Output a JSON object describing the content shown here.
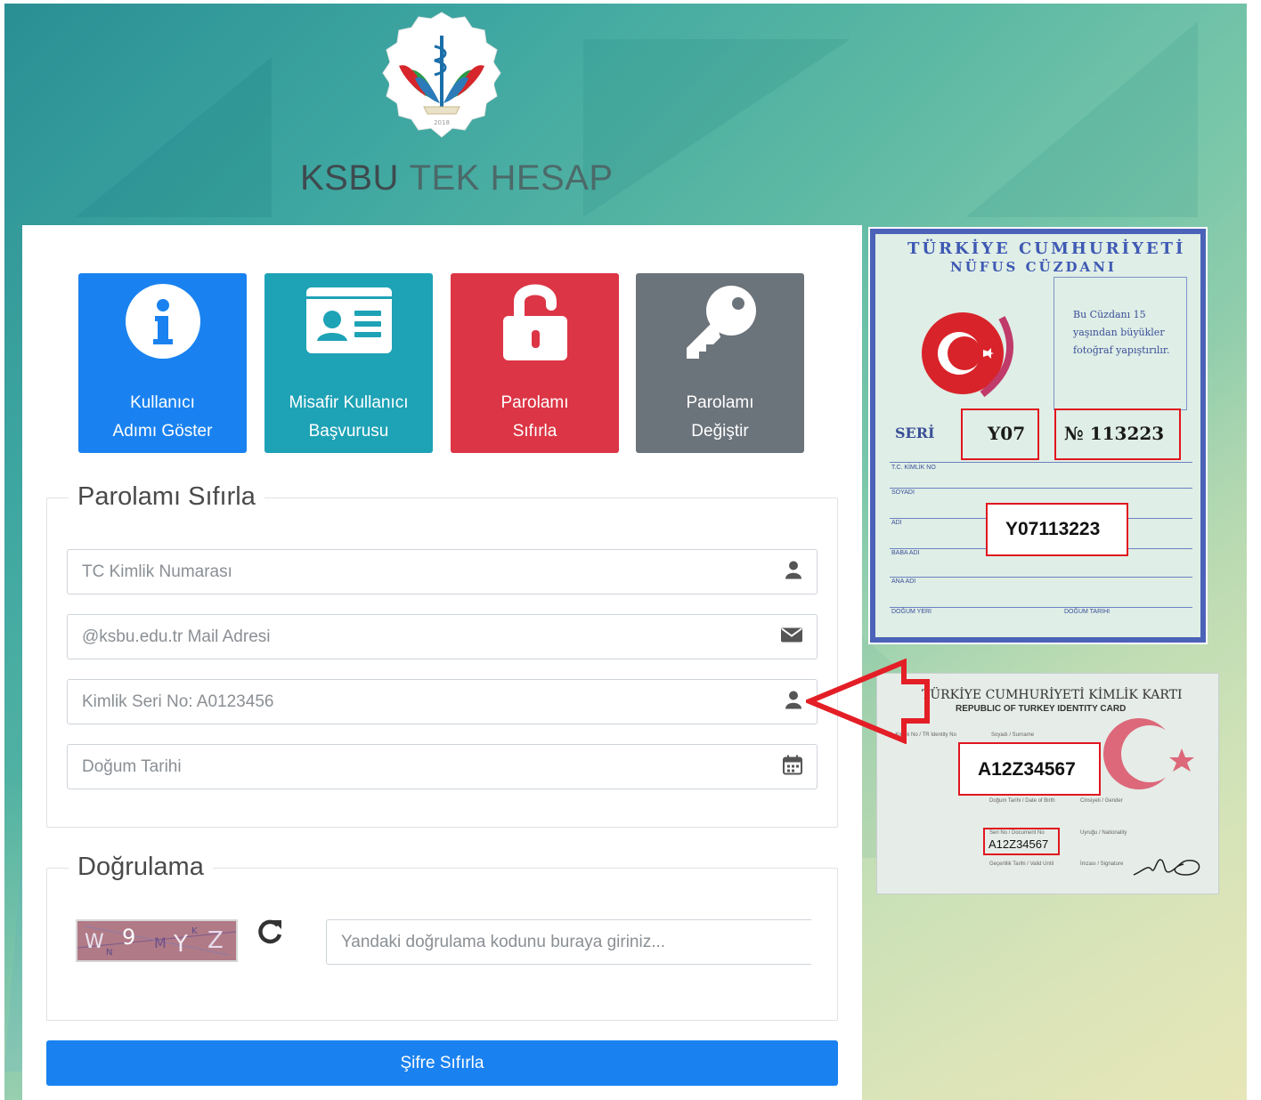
{
  "header": {
    "brand_bold": "KSBU",
    "brand_light": "TEK HESAP"
  },
  "logo": {
    "icon": "ksbu-caduceus-logo-icon",
    "year": "2018"
  },
  "tiles": [
    {
      "label_line1": "Kullanıcı",
      "label_line2": "Adımı Göster",
      "icon": "info-icon",
      "color": "#1a82f0"
    },
    {
      "label_line1": "Misafir Kullanıcı",
      "label_line2": "Başvurusu",
      "icon": "id-card-icon",
      "color": "#1ea2b6"
    },
    {
      "label_line1": "Parolamı",
      "label_line2": "Sıfırla",
      "icon": "unlock-icon",
      "color": "#dc3545"
    },
    {
      "label_line1": "Parolamı",
      "label_line2": "Değiştir",
      "icon": "key-icon",
      "color": "#6b737b"
    }
  ],
  "reset_form": {
    "legend": "Parolamı Sıfırla",
    "fields": [
      {
        "placeholder": "TC Kimlik Numarası",
        "value": "",
        "icon": "user-icon"
      },
      {
        "placeholder": "@ksbu.edu.tr Mail Adresi",
        "value": "",
        "icon": "envelope-icon"
      },
      {
        "placeholder": "Kimlik Seri No: A0123456",
        "value": "",
        "icon": "user-icon"
      },
      {
        "placeholder": "Doğum Tarihi",
        "value": "",
        "icon": "calendar-icon"
      }
    ]
  },
  "verification": {
    "legend": "Doğrulama",
    "captcha_text": "W 9 Y Z",
    "captcha_placeholder": "Yandaki doğrulama kodunu buraya giriniz...",
    "refresh_icon": "refresh-icon"
  },
  "submit_label": "Şifre Sıfırla",
  "old_id_card": {
    "title_line1": "TÜRKİYE CUMHURİYETİ",
    "title_line2": "NÜFUS CÜZDANI",
    "note_line1": "Bu Cüzdanı 15",
    "note_line2": "yaşından büyükler",
    "note_line3": "fotoğraf yapıştırılır.",
    "seri_label": "SERİ",
    "seri_value": "Y07",
    "no_value": "№ 113223",
    "combined_value": "Y07113223",
    "row_labels": [
      "T.C. KİMLİK NO",
      "SOYADI",
      "ADI",
      "BABA ADI",
      "ANA ADI",
      "DOĞUM YERİ",
      "DOĞUM TARİHİ"
    ]
  },
  "new_id_card": {
    "title": "TÜRKİYE CUMHURİYETİ KİMLİK KARTI",
    "subtitle": "REPUBLIC OF TURKEY IDENTITY CARD",
    "serial_big": "A12Z34567",
    "serial_small": "A12Z34567",
    "labels": [
      "T.C. Kimlik No / TR Identity No",
      "Soyadı / Surname",
      "Doğum Tarihi / Date of Birth",
      "Cinsiyeti / Gender",
      "Seri No / Document No",
      "Uyruğu / Nationality",
      "Geçerlilik Tarihi / Valid Until",
      "İmzası / Signature"
    ]
  },
  "colors": {
    "primary": "#1a82f0",
    "teal": "#1ea2b6",
    "danger": "#dc3545",
    "secondary": "#6b737b",
    "highlight_red": "#e1161e"
  }
}
